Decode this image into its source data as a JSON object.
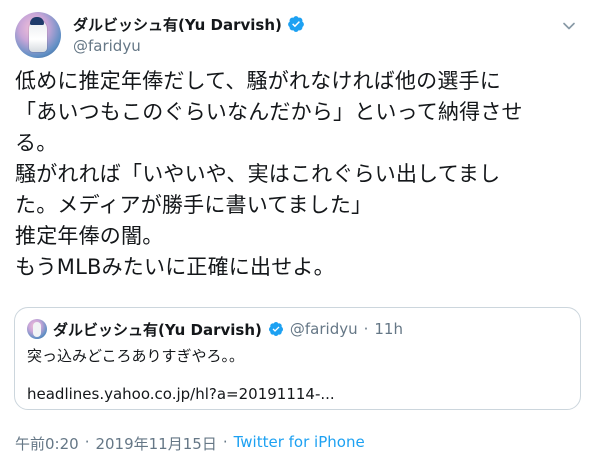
{
  "author": {
    "display_name": "ダルビッシュ有(Yu Darvish)",
    "handle": "@faridyu",
    "avatar_icon": "pitcher-avatar-icon",
    "verified_icon": "verified-badge-icon"
  },
  "tweet": {
    "lines": [
      "低めに推定年俸だして、騒がれなければ他の選手に",
      "「あいつもこのぐらいなんだから」といって納得させ",
      "る。",
      "騒がれれば「いやいや、実はこれぐらい出してまし",
      "た。メディアが勝手に書いてました」",
      "推定年俸の闇。",
      "もうMLBみたいに正確に出せよ。"
    ]
  },
  "quoted_tweet": {
    "display_name": "ダルビッシュ有(Yu Darvish)",
    "handle": "@faridyu",
    "separator": "·",
    "time": "11h",
    "text": "突っ込みどころありすぎやろ。。",
    "link": "headlines.yahoo.co.jp/hl?a=20191114-..."
  },
  "footer": {
    "time": "午前0:20",
    "separator1": "·",
    "date": "2019年11月15日",
    "separator2": "·",
    "source": "Twitter for iPhone"
  },
  "colors": {
    "text": "#14171a",
    "secondary": "#657786",
    "accent": "#1da1f2",
    "border": "#ccd6dd"
  }
}
